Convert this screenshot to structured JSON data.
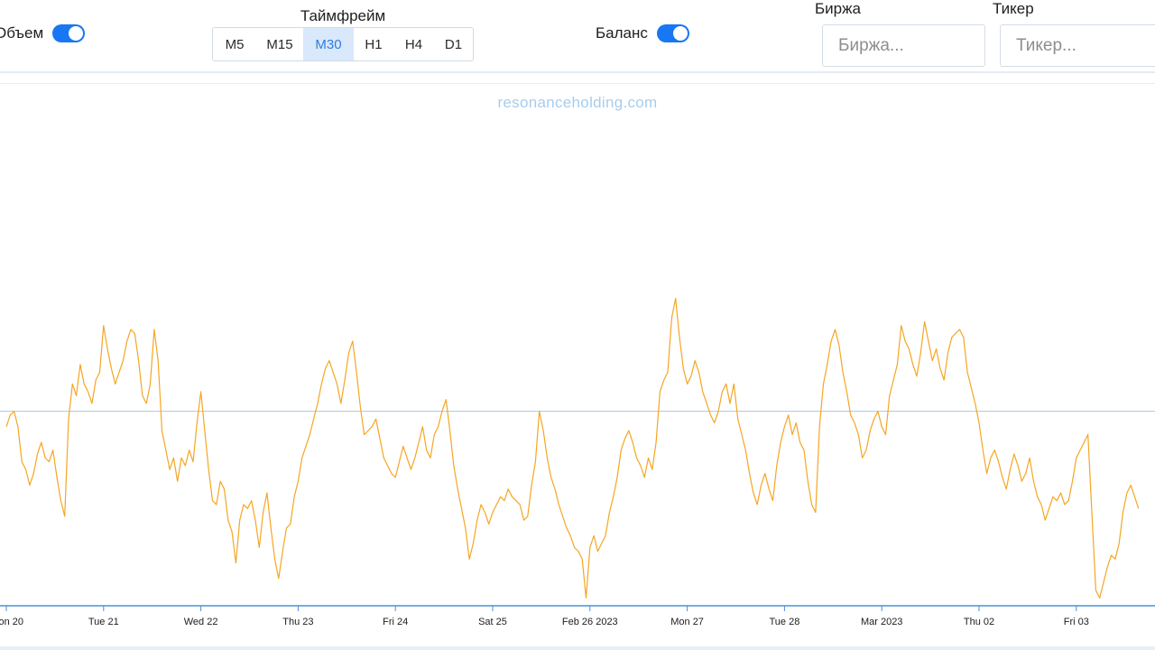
{
  "toolbar": {
    "volume": {
      "label": "Объем",
      "enabled": true
    },
    "timeframe": {
      "title": "Таймфрейм",
      "options": [
        "M5",
        "M15",
        "M30",
        "H1",
        "H4",
        "D1"
      ],
      "selected": "M30"
    },
    "balance": {
      "label": "Баланс",
      "enabled": true
    },
    "exchange": {
      "label": "Биржа",
      "placeholder": "Биржа...",
      "value": ""
    },
    "ticker": {
      "label": "Тикер",
      "placeholder": "Тикер...",
      "value": ""
    }
  },
  "chart": {
    "watermark": "resonanceholding.com",
    "line_color": "#f5a623",
    "axis_color": "#4a90d9",
    "reference_line_color": "#a9cde8"
  },
  "chart_data": {
    "type": "line",
    "x_tick_labels": [
      "on 20",
      "Tue 21",
      "Wed 22",
      "Thu 23",
      "Fri 24",
      "Sat 25",
      "Feb 26 2023",
      "Mon 27",
      "Tue 28",
      "Mar 2023",
      "Thu 02",
      "Fri 03"
    ],
    "x_range": [
      0,
      11.85
    ],
    "y_range": [
      0,
      100
    ],
    "reference_level": 50,
    "series": [
      {
        "values": [
          [
            0.0,
            46
          ],
          [
            0.04,
            49
          ],
          [
            0.08,
            50
          ],
          [
            0.12,
            46
          ],
          [
            0.16,
            37
          ],
          [
            0.2,
            35
          ],
          [
            0.24,
            31
          ],
          [
            0.28,
            34
          ],
          [
            0.32,
            39
          ],
          [
            0.36,
            42
          ],
          [
            0.4,
            38
          ],
          [
            0.44,
            37
          ],
          [
            0.48,
            40
          ],
          [
            0.52,
            33
          ],
          [
            0.56,
            27
          ],
          [
            0.6,
            23
          ],
          [
            0.64,
            48
          ],
          [
            0.68,
            57
          ],
          [
            0.72,
            54
          ],
          [
            0.76,
            62
          ],
          [
            0.8,
            57
          ],
          [
            0.84,
            55
          ],
          [
            0.88,
            52
          ],
          [
            0.92,
            58
          ],
          [
            0.96,
            60
          ],
          [
            1.0,
            72
          ],
          [
            1.04,
            66
          ],
          [
            1.08,
            61
          ],
          [
            1.12,
            57
          ],
          [
            1.16,
            60
          ],
          [
            1.2,
            63
          ],
          [
            1.24,
            68
          ],
          [
            1.28,
            71
          ],
          [
            1.32,
            70
          ],
          [
            1.36,
            63
          ],
          [
            1.4,
            54
          ],
          [
            1.44,
            52
          ],
          [
            1.48,
            57
          ],
          [
            1.52,
            71
          ],
          [
            1.56,
            63
          ],
          [
            1.6,
            45
          ],
          [
            1.64,
            40
          ],
          [
            1.68,
            35
          ],
          [
            1.72,
            38
          ],
          [
            1.76,
            32
          ],
          [
            1.8,
            38
          ],
          [
            1.84,
            36
          ],
          [
            1.88,
            40
          ],
          [
            1.92,
            37
          ],
          [
            1.96,
            47
          ],
          [
            2.0,
            55
          ],
          [
            2.04,
            45
          ],
          [
            2.08,
            35
          ],
          [
            2.12,
            27
          ],
          [
            2.16,
            26
          ],
          [
            2.2,
            32
          ],
          [
            2.24,
            30
          ],
          [
            2.28,
            22
          ],
          [
            2.32,
            19
          ],
          [
            2.36,
            11
          ],
          [
            2.4,
            22
          ],
          [
            2.44,
            26
          ],
          [
            2.48,
            25
          ],
          [
            2.52,
            27
          ],
          [
            2.56,
            22
          ],
          [
            2.6,
            15
          ],
          [
            2.64,
            24
          ],
          [
            2.68,
            29
          ],
          [
            2.72,
            20
          ],
          [
            2.76,
            12
          ],
          [
            2.8,
            7
          ],
          [
            2.84,
            14
          ],
          [
            2.88,
            20
          ],
          [
            2.92,
            21
          ],
          [
            2.96,
            28
          ],
          [
            3.0,
            32
          ],
          [
            3.04,
            38
          ],
          [
            3.08,
            41
          ],
          [
            3.12,
            44
          ],
          [
            3.16,
            48
          ],
          [
            3.2,
            52
          ],
          [
            3.24,
            57
          ],
          [
            3.28,
            61
          ],
          [
            3.32,
            63
          ],
          [
            3.36,
            60
          ],
          [
            3.4,
            57
          ],
          [
            3.44,
            52
          ],
          [
            3.48,
            58
          ],
          [
            3.52,
            65
          ],
          [
            3.56,
            68
          ],
          [
            3.6,
            60
          ],
          [
            3.64,
            51
          ],
          [
            3.68,
            44
          ],
          [
            3.72,
            45
          ],
          [
            3.76,
            46
          ],
          [
            3.8,
            48
          ],
          [
            3.84,
            43
          ],
          [
            3.88,
            38
          ],
          [
            3.92,
            36
          ],
          [
            3.96,
            34
          ],
          [
            4.0,
            33
          ],
          [
            4.04,
            37
          ],
          [
            4.08,
            41
          ],
          [
            4.12,
            38
          ],
          [
            4.16,
            35
          ],
          [
            4.2,
            38
          ],
          [
            4.24,
            42
          ],
          [
            4.28,
            46
          ],
          [
            4.32,
            40
          ],
          [
            4.36,
            38
          ],
          [
            4.4,
            44
          ],
          [
            4.44,
            46
          ],
          [
            4.48,
            50
          ],
          [
            4.52,
            53
          ],
          [
            4.56,
            45
          ],
          [
            4.6,
            36
          ],
          [
            4.64,
            30
          ],
          [
            4.68,
            25
          ],
          [
            4.72,
            20
          ],
          [
            4.76,
            12
          ],
          [
            4.8,
            16
          ],
          [
            4.84,
            22
          ],
          [
            4.88,
            26
          ],
          [
            4.92,
            24
          ],
          [
            4.96,
            21
          ],
          [
            5.0,
            24
          ],
          [
            5.04,
            26
          ],
          [
            5.08,
            28
          ],
          [
            5.12,
            27
          ],
          [
            5.16,
            30
          ],
          [
            5.2,
            28
          ],
          [
            5.24,
            27
          ],
          [
            5.28,
            26
          ],
          [
            5.32,
            22
          ],
          [
            5.36,
            23
          ],
          [
            5.4,
            31
          ],
          [
            5.44,
            37
          ],
          [
            5.48,
            50
          ],
          [
            5.52,
            45
          ],
          [
            5.56,
            38
          ],
          [
            5.6,
            33
          ],
          [
            5.64,
            30
          ],
          [
            5.68,
            26
          ],
          [
            5.72,
            23
          ],
          [
            5.76,
            20
          ],
          [
            5.8,
            18
          ],
          [
            5.84,
            15
          ],
          [
            5.88,
            14
          ],
          [
            5.92,
            12
          ],
          [
            5.96,
            2
          ],
          [
            6.0,
            15
          ],
          [
            6.04,
            18
          ],
          [
            6.08,
            14
          ],
          [
            6.12,
            16
          ],
          [
            6.16,
            18
          ],
          [
            6.2,
            24
          ],
          [
            6.24,
            28
          ],
          [
            6.28,
            33
          ],
          [
            6.32,
            40
          ],
          [
            6.36,
            43
          ],
          [
            6.4,
            45
          ],
          [
            6.44,
            42
          ],
          [
            6.48,
            38
          ],
          [
            6.52,
            36
          ],
          [
            6.56,
            33
          ],
          [
            6.6,
            38
          ],
          [
            6.64,
            35
          ],
          [
            6.68,
            42
          ],
          [
            6.72,
            55
          ],
          [
            6.76,
            58
          ],
          [
            6.8,
            60
          ],
          [
            6.84,
            74
          ],
          [
            6.88,
            79
          ],
          [
            6.92,
            69
          ],
          [
            6.96,
            61
          ],
          [
            7.0,
            57
          ],
          [
            7.04,
            59
          ],
          [
            7.08,
            63
          ],
          [
            7.12,
            60
          ],
          [
            7.16,
            55
          ],
          [
            7.2,
            52
          ],
          [
            7.24,
            49
          ],
          [
            7.28,
            47
          ],
          [
            7.32,
            50
          ],
          [
            7.36,
            55
          ],
          [
            7.4,
            57
          ],
          [
            7.44,
            52
          ],
          [
            7.48,
            57
          ],
          [
            7.52,
            48
          ],
          [
            7.56,
            44
          ],
          [
            7.6,
            40
          ],
          [
            7.64,
            34
          ],
          [
            7.68,
            29
          ],
          [
            7.72,
            26
          ],
          [
            7.76,
            31
          ],
          [
            7.8,
            34
          ],
          [
            7.84,
            30
          ],
          [
            7.88,
            27
          ],
          [
            7.92,
            36
          ],
          [
            7.96,
            42
          ],
          [
            8.0,
            46
          ],
          [
            8.04,
            49
          ],
          [
            8.08,
            44
          ],
          [
            8.12,
            47
          ],
          [
            8.16,
            42
          ],
          [
            8.2,
            40
          ],
          [
            8.24,
            32
          ],
          [
            8.28,
            26
          ],
          [
            8.32,
            24
          ],
          [
            8.36,
            46
          ],
          [
            8.4,
            57
          ],
          [
            8.44,
            62
          ],
          [
            8.48,
            68
          ],
          [
            8.52,
            71
          ],
          [
            8.56,
            67
          ],
          [
            8.6,
            60
          ],
          [
            8.64,
            55
          ],
          [
            8.68,
            49
          ],
          [
            8.72,
            47
          ],
          [
            8.76,
            44
          ],
          [
            8.8,
            38
          ],
          [
            8.84,
            40
          ],
          [
            8.88,
            45
          ],
          [
            8.92,
            48
          ],
          [
            8.96,
            50
          ],
          [
            9.0,
            46
          ],
          [
            9.04,
            44
          ],
          [
            9.08,
            54
          ],
          [
            9.12,
            58
          ],
          [
            9.16,
            62
          ],
          [
            9.2,
            72
          ],
          [
            9.24,
            68
          ],
          [
            9.28,
            66
          ],
          [
            9.32,
            62
          ],
          [
            9.36,
            59
          ],
          [
            9.4,
            65
          ],
          [
            9.44,
            73
          ],
          [
            9.48,
            68
          ],
          [
            9.52,
            63
          ],
          [
            9.56,
            66
          ],
          [
            9.6,
            61
          ],
          [
            9.64,
            58
          ],
          [
            9.68,
            65
          ],
          [
            9.72,
            69
          ],
          [
            9.76,
            70
          ],
          [
            9.8,
            71
          ],
          [
            9.84,
            69
          ],
          [
            9.88,
            60
          ],
          [
            9.92,
            56
          ],
          [
            9.96,
            52
          ],
          [
            10.0,
            47
          ],
          [
            10.04,
            40
          ],
          [
            10.08,
            34
          ],
          [
            10.12,
            38
          ],
          [
            10.16,
            40
          ],
          [
            10.2,
            37
          ],
          [
            10.24,
            33
          ],
          [
            10.28,
            30
          ],
          [
            10.32,
            35
          ],
          [
            10.36,
            39
          ],
          [
            10.4,
            36
          ],
          [
            10.44,
            32
          ],
          [
            10.48,
            34
          ],
          [
            10.52,
            38
          ],
          [
            10.56,
            32
          ],
          [
            10.6,
            28
          ],
          [
            10.64,
            26
          ],
          [
            10.68,
            22
          ],
          [
            10.72,
            25
          ],
          [
            10.76,
            28
          ],
          [
            10.8,
            27
          ],
          [
            10.84,
            29
          ],
          [
            10.88,
            26
          ],
          [
            10.92,
            27
          ],
          [
            10.96,
            32
          ],
          [
            11.0,
            38
          ],
          [
            11.04,
            40
          ],
          [
            11.08,
            42
          ],
          [
            11.12,
            44
          ],
          [
            11.16,
            24
          ],
          [
            11.2,
            4
          ],
          [
            11.24,
            2
          ],
          [
            11.28,
            6
          ],
          [
            11.32,
            10
          ],
          [
            11.36,
            13
          ],
          [
            11.4,
            12
          ],
          [
            11.44,
            16
          ],
          [
            11.48,
            24
          ],
          [
            11.52,
            29
          ],
          [
            11.56,
            31
          ],
          [
            11.6,
            28
          ],
          [
            11.64,
            25
          ]
        ]
      }
    ]
  }
}
